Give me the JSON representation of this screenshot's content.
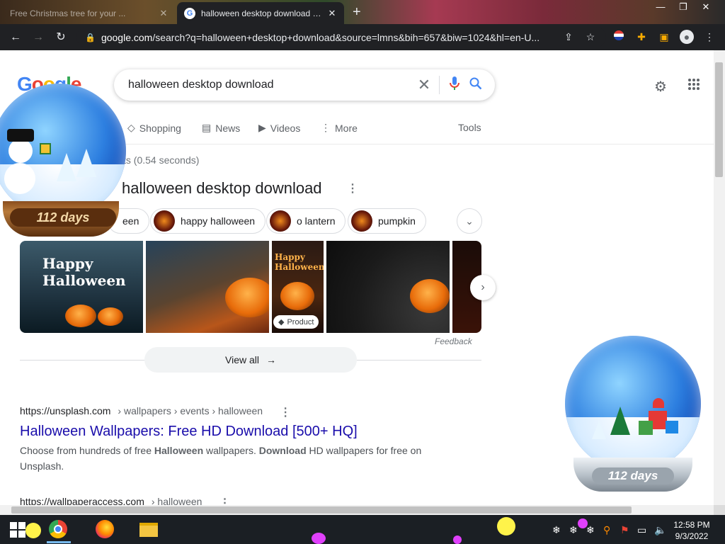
{
  "browser": {
    "tabs": [
      {
        "title": "Free Christmas tree for your ...",
        "active": false
      },
      {
        "title": "halloween desktop download - G",
        "active": true
      }
    ],
    "new_tab_label": "+",
    "url_host": "google.com",
    "url_rest": "/search?q=halloween+desktop+download&source=lmns&bih=657&biw=1024&hl=en-U...",
    "nav": {
      "back": "←",
      "forward": "→",
      "reload": "↻"
    },
    "window_controls": {
      "minimize": "—",
      "maximize": "❐",
      "close": "✕"
    }
  },
  "google": {
    "logo": "Google",
    "query": "halloween desktop download",
    "search_tabs": [
      {
        "icon": "tag-icon",
        "glyph": "◇",
        "label": "Shopping"
      },
      {
        "icon": "news-icon",
        "glyph": "▤",
        "label": "News"
      },
      {
        "icon": "video-icon",
        "glyph": "▶",
        "label": "Videos"
      },
      {
        "icon": "more-icon",
        "glyph": "⋮",
        "label": "More"
      }
    ],
    "tools_label": "Tools",
    "stats_fragment": "ts (0.54 seconds)",
    "images_header": "halloween desktop download",
    "chips": [
      {
        "label": "een"
      },
      {
        "label": "happy halloween"
      },
      {
        "label": "o lantern"
      },
      {
        "label": "pumpkin"
      }
    ],
    "tiles": [
      {
        "caption": "Happy Halloween"
      },
      {
        "caption": ""
      },
      {
        "caption": "Happy Halloween"
      },
      {
        "caption": ""
      },
      {
        "caption": ""
      }
    ],
    "product_badge": "Product",
    "feedback": "Feedback",
    "view_all": "View all",
    "results": [
      {
        "site": "https://unsplash.com",
        "path": "› wallpapers › events › halloween",
        "title": "Halloween Wallpapers: Free HD Download [500+ HQ]",
        "snippet_parts": [
          {
            "t": "Choose from hundreds of free ",
            "b": false
          },
          {
            "t": "Halloween",
            "b": true
          },
          {
            "t": " wallpapers. ",
            "b": false
          },
          {
            "t": "Download",
            "b": true
          },
          {
            "t": " HD wallpapers for free on Unsplash.",
            "b": false
          }
        ]
      },
      {
        "site": "https://wallpaperaccess.com",
        "path": "› halloween"
      }
    ]
  },
  "widgets": {
    "globe_left_days": "112 days",
    "globe_right_days": "112 days"
  },
  "taskbar": {
    "clock_time": "12:58 PM",
    "clock_date": "9/3/2022"
  },
  "colors": {
    "link": "#1a0dab",
    "google_blue": "#4285f4",
    "google_red": "#ea4335",
    "google_yellow": "#fbbc05",
    "google_green": "#34a853",
    "chrome_dark": "#202124"
  }
}
